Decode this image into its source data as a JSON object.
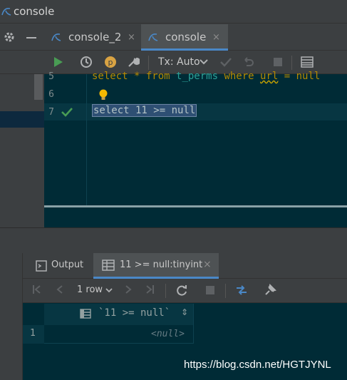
{
  "window": {
    "title": "console"
  },
  "tabs": [
    {
      "label": "console_2",
      "close": "×"
    },
    {
      "label": "console",
      "close": "×"
    }
  ],
  "toolbar": {
    "transaction_mode": "Tx: Auto",
    "profile_badge": "p"
  },
  "editor": {
    "line_numbers": [
      "5",
      "6",
      "7"
    ],
    "line5": {
      "kw1": "select",
      "star": " * ",
      "kw2": "from",
      "table": " t_perms ",
      "kw3": "where",
      "space": " ",
      "col": "url",
      "rest": " = null"
    },
    "line7": "select 11 >= null"
  },
  "results": {
    "tabs": [
      {
        "label": "Output"
      },
      {
        "label": "11 >= null:tinyint",
        "close": "×"
      }
    ],
    "row_count": "1 row",
    "column_header": "`11 >= null`",
    "sort_glyph": "⇕",
    "rows": [
      {
        "num": "1",
        "value": "<null>"
      }
    ]
  },
  "watermark": "https://blog.csdn.net/HGTJYNL",
  "colors": {
    "editor_bg": "#002b36",
    "accent": "#4a88c7",
    "run_green": "#499c54"
  }
}
